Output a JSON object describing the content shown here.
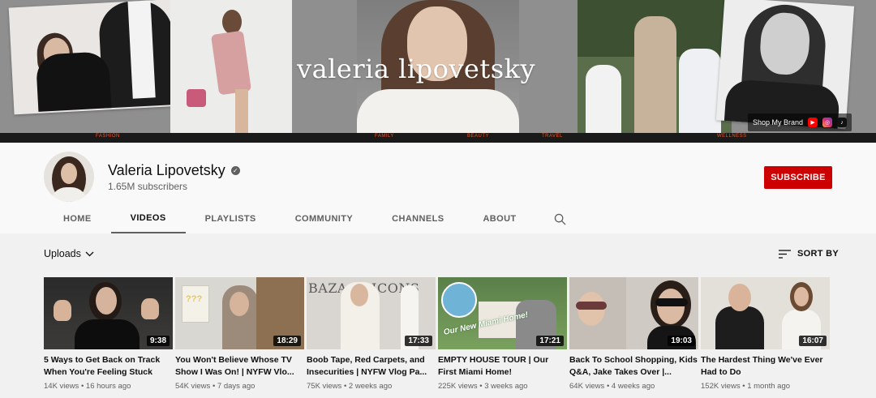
{
  "banner": {
    "title": "valeria lipovetsky",
    "strip_labels": [
      "FASHION",
      "FAMILY",
      "BEAUTY",
      "TRAVEL",
      "WELLNESS"
    ],
    "shop_label": "Shop My Brand",
    "social_icons": [
      "youtube-icon",
      "instagram-icon",
      "tiktok-icon"
    ]
  },
  "channel": {
    "name": "Valeria Lipovetsky",
    "subscribers": "1.65M subscribers",
    "subscribe_label": "SUBSCRIBE",
    "tabs": [
      {
        "label": "HOME",
        "active": false
      },
      {
        "label": "VIDEOS",
        "active": true
      },
      {
        "label": "PLAYLISTS",
        "active": false
      },
      {
        "label": "COMMUNITY",
        "active": false
      },
      {
        "label": "CHANNELS",
        "active": false
      },
      {
        "label": "ABOUT",
        "active": false
      }
    ]
  },
  "toolbar": {
    "uploads_label": "Uploads",
    "sort_label": "SORT BY"
  },
  "videos": [
    {
      "title": "5 Ways to Get Back on Track When You're Feeling Stuck",
      "duration": "9:38",
      "views": "14K views",
      "age": "16 hours ago"
    },
    {
      "title": "You Won't Believe Whose TV Show I Was On! | NYFW Vlo...",
      "duration": "18:29",
      "views": "54K views",
      "age": "7 days ago"
    },
    {
      "title": "Boob Tape, Red Carpets, and Insecurities | NYFW Vlog Pa...",
      "duration": "17:33",
      "views": "75K views",
      "age": "2 weeks ago"
    },
    {
      "title": "EMPTY HOUSE TOUR | Our First Miami Home!",
      "duration": "17:21",
      "views": "225K views",
      "age": "3 weeks ago"
    },
    {
      "title": "Back To School Shopping, Kids Q&A, Jake Takes Over |...",
      "duration": "19:03",
      "views": "64K views",
      "age": "4 weeks ago"
    },
    {
      "title": "The Hardest Thing We've Ever Had to Do",
      "duration": "16:07",
      "views": "152K views",
      "age": "1 month ago"
    }
  ],
  "thumb_text": {
    "t2_sign": "???",
    "t3_text": "BAZAAR ICONS",
    "t4_text": "Our New Miami Home!"
  }
}
